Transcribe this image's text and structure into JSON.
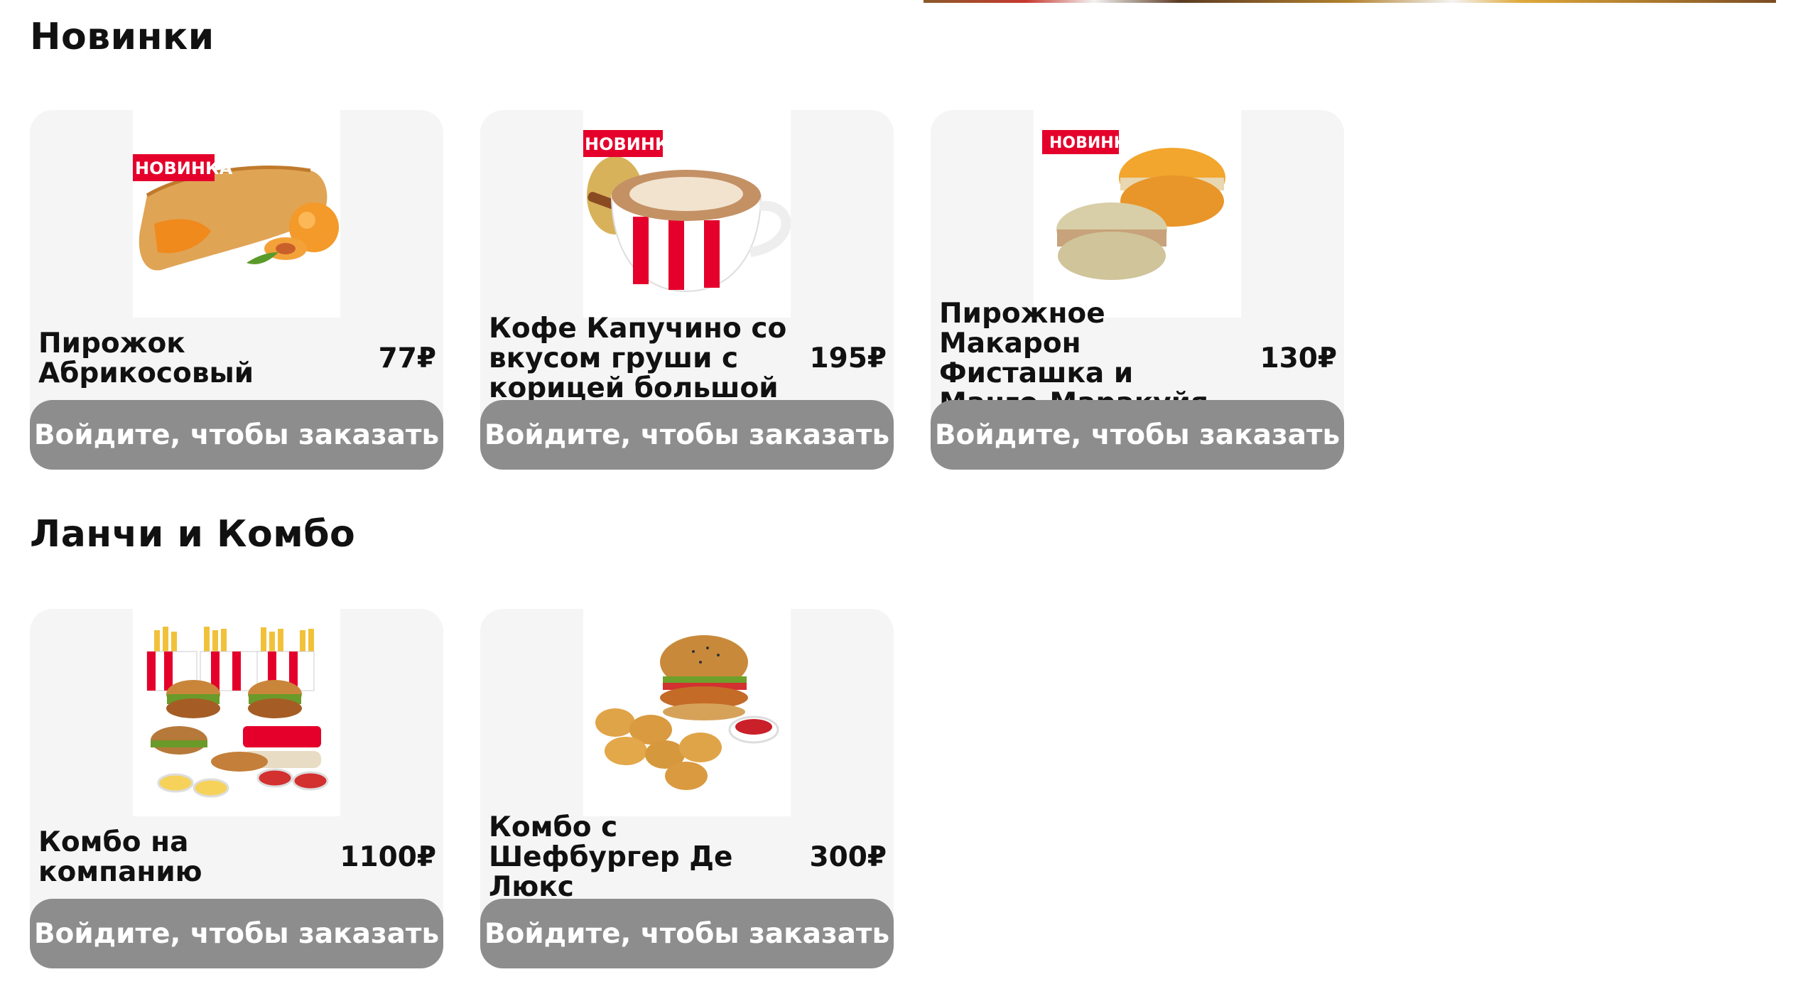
{
  "sections": [
    {
      "title": "Новинки",
      "items": [
        {
          "name": "Пирожок Абрикосовый",
          "price": "77₽",
          "badge": "НОВИНКА",
          "button": "Войдите, чтобы заказать"
        },
        {
          "name": "Кофе Капучино со вкусом груши с корицей большой",
          "price": "195₽",
          "badge": "НОВИНКА",
          "button": "Войдите, чтобы заказать"
        },
        {
          "name": "Пирожное Макарон Фисташка и Манго-Маракуйя",
          "price": "130₽",
          "badge": "НОВИНКА",
          "button": "Войдите, чтобы заказать"
        }
      ]
    },
    {
      "title": "Ланчи и Комбо",
      "items": [
        {
          "name": "Комбо на компанию",
          "price": "1100₽",
          "button": "Войдите, чтобы заказать"
        },
        {
          "name": "Комбо с Шефбургер Де Люкс",
          "price": "300₽",
          "button": "Войдите, чтобы заказать"
        }
      ]
    }
  ],
  "colors": {
    "badge_red": "#e4002b",
    "button_gray": "#8d8d8d",
    "card_bg": "#f5f5f5"
  }
}
